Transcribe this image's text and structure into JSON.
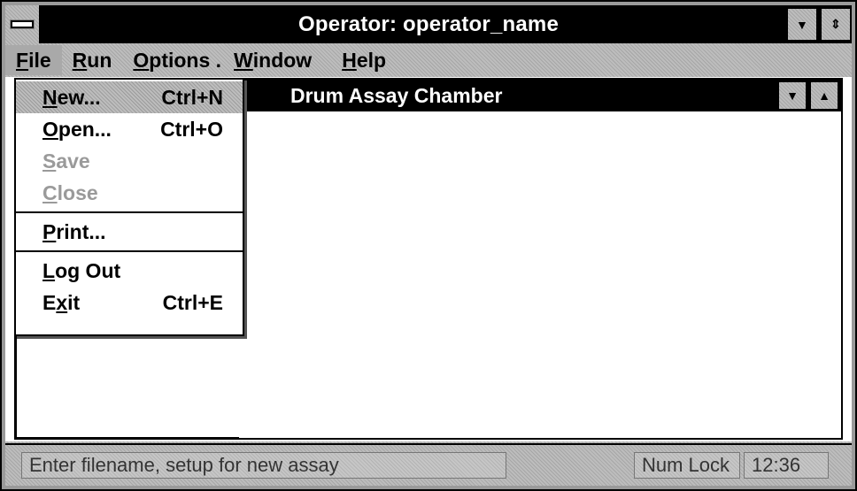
{
  "window": {
    "title": "Operator: operator_name"
  },
  "menubar": {
    "items": [
      {
        "label": "File",
        "accel": "F",
        "rest": "ile"
      },
      {
        "label": "Run",
        "accel": "R",
        "rest": "un"
      },
      {
        "label": "Options",
        "accel": "O",
        "rest": "ptions ."
      },
      {
        "label": "Window",
        "accel": "W",
        "rest": "indow"
      },
      {
        "label": "Help",
        "accel": "H",
        "rest": "elp"
      }
    ]
  },
  "file_menu": {
    "items": [
      {
        "pre": "",
        "accel": "N",
        "rest": "ew...",
        "shortcut": "Ctrl+N",
        "state": "highlighted"
      },
      {
        "pre": "",
        "accel": "O",
        "rest": "pen...",
        "shortcut": "Ctrl+O",
        "state": "enabled"
      },
      {
        "pre": "",
        "accel": "S",
        "rest": "ave",
        "shortcut": "",
        "state": "disabled"
      },
      {
        "pre": "",
        "accel": "C",
        "rest": "lose",
        "shortcut": "",
        "state": "disabled"
      },
      {
        "pre": "",
        "accel": "P",
        "rest": "rint...",
        "shortcut": "",
        "state": "enabled"
      },
      {
        "pre": "",
        "accel": "L",
        "rest": "og Out",
        "shortcut": "",
        "state": "enabled"
      },
      {
        "pre": "E",
        "accel": "x",
        "rest": "it",
        "shortcut": "Ctrl+E",
        "state": "enabled"
      }
    ]
  },
  "child_window": {
    "title": "Drum Assay Chamber"
  },
  "statusbar": {
    "message": "Enter filename, setup for new assay",
    "numlock": "Num Lock",
    "time": "12:36"
  },
  "colors": {
    "titlebar": "#000000",
    "dither": "#bdbdbd",
    "disabled_text": "#9a9a9a"
  },
  "icons": [
    "system-menu-icon",
    "minimize-arrow-icon",
    "maximize-arrow-icon",
    "restore-arrows-icon"
  ]
}
